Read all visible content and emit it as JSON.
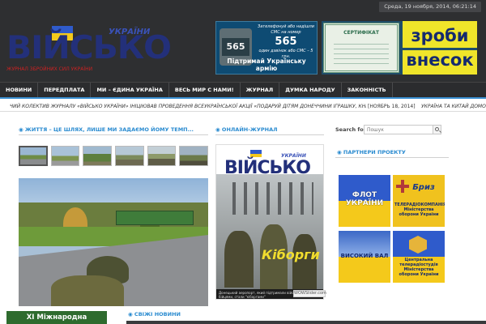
{
  "header": {
    "date_time": "Среда, 19 ноября, 2014, 06:21:14",
    "logo": {
      "word": "ВІЙСЬКО",
      "sub": "УКРАЇНИ",
      "tagline": "ЖУРНАЛ ЗБРОЙНИХ СИЛ УКРАЇНИ"
    },
    "banner_sms": {
      "text_top": "Зателефонуй або надішли СМС на номер",
      "number": "565",
      "phone_number": "565",
      "text_sms": "один дзвінок або СМС – 5 грн.",
      "text_bottom": "Підтримай Українську армію"
    },
    "banner_donate": {
      "certificate": "СЕРТИФІКАТ",
      "word1": "зроби",
      "word2": "внесок"
    }
  },
  "nav": {
    "items": [
      {
        "label": "НОВИНИ"
      },
      {
        "label": "ПЕРЕДПЛАТА"
      },
      {
        "label": "МИ – ЄДИНА УКРАЇНА"
      },
      {
        "label": "ВЕСЬ МИР С НАМИ!"
      },
      {
        "label": "ЖУРНАЛ"
      },
      {
        "label": "ДУМКА НАРОДУ"
      },
      {
        "label": "ЗАКОННІСТЬ"
      }
    ]
  },
  "ticker": {
    "text": "ЧИЙ КОЛЕКТИВ ЖУРНАЛУ «ВІЙСЬКО УКРАЇНИ» ІНІЦІЮВАВ ПРОВЕДЕННЯ ВСЕУКРАЇНСЬКОЇ АКЦІЇ «ПОДАРУЙ ДІТЯМ ДОНЕЧЧИНИ ІГРАШКУ, КНИЖКУ І ЦУКЕРКУ» ✕",
    "date": "[НОЯБРЬ 18, 2014]",
    "text2": "УКРАЇНА ТА КИТАЙ ДОМОВ"
  },
  "sections": {
    "life": "◉ ЖИТТЯ – ЦЕ ШЛЯХ, ЛИШЕ МИ ЗАДАЄМО ЙОМУ ТЕМП...",
    "online": "◉ ОНЛАЙН-ЖУРНАЛ",
    "partners": "◉ ПАРТНЕРИ ПРОЕКТУ",
    "news": "◉ СВІЖІ НОВИНИ"
  },
  "search": {
    "label": "Search for:",
    "placeholder": "Пошук"
  },
  "magazine": {
    "word": "ВІЙСЬКО",
    "sub": "УКРАЇНИ",
    "cover_title": "Кіборги",
    "footer_text": "Донецький аеропорт, який підтримали військові разом із бійцями, стали \"кіборгами\"",
    "badge": "WOWSlider.com"
  },
  "partners": [
    {
      "name": "ФЛОТ УКРАЇНИ"
    },
    {
      "name": "Бриз",
      "desc": "ТЕЛЕРАДІОКОМПАНІЯ Міністерства оборони України"
    },
    {
      "name": "ВИСОКИЙ ВАЛ"
    },
    {
      "name": "Центральна телерадіостудія Міністерства оборони України"
    }
  ],
  "bottom_banner": "ХІ Міжнародна",
  "colors": {
    "accent": "#2a8bd0",
    "header_bg": "#2e2f31",
    "logo_blue": "#23307a",
    "flag_blue": "#2f5bcb",
    "flag_yellow": "#f4c91b"
  }
}
